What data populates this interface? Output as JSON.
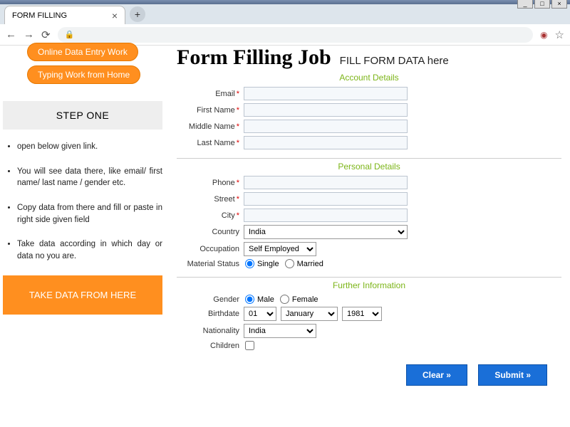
{
  "browser": {
    "tab_title": "FORM FILLING",
    "address": ""
  },
  "sidebar": {
    "pill1": "Online Data Entry Work",
    "pill2": "Typing Work from Home",
    "step_heading": "STEP ONE",
    "steps": [
      "open below given link.",
      "You will see data there, like email/ first name/ last name / gender etc.",
      "Copy data from there and fill or paste in right side given field",
      "Take data according in which day or data no you are."
    ],
    "cta": "TAKE DATA FROM HERE"
  },
  "header": {
    "title": "Form Filling Job",
    "subtitle": "FILL FORM DATA here"
  },
  "sections": {
    "account": "Account Details",
    "personal": "Personal Details",
    "further": "Further Information"
  },
  "labels": {
    "email": "Email",
    "first_name": "First Name",
    "middle_name": "Middle Name",
    "last_name": "Last Name",
    "phone": "Phone",
    "street": "Street",
    "city": "City",
    "country": "Country",
    "occupation": "Occupation",
    "material_status": "Material Status",
    "gender": "Gender",
    "birthdate": "Birthdate",
    "nationality": "Nationality",
    "children": "Children"
  },
  "values": {
    "country": "India",
    "occupation": "Self Employed",
    "material_single": "Single",
    "material_married": "Married",
    "gender_male": "Male",
    "gender_female": "Female",
    "birth_day": "01",
    "birth_month": "January",
    "birth_year": "1981",
    "nationality": "India"
  },
  "buttons": {
    "clear": "Clear »",
    "submit": "Submit »"
  }
}
